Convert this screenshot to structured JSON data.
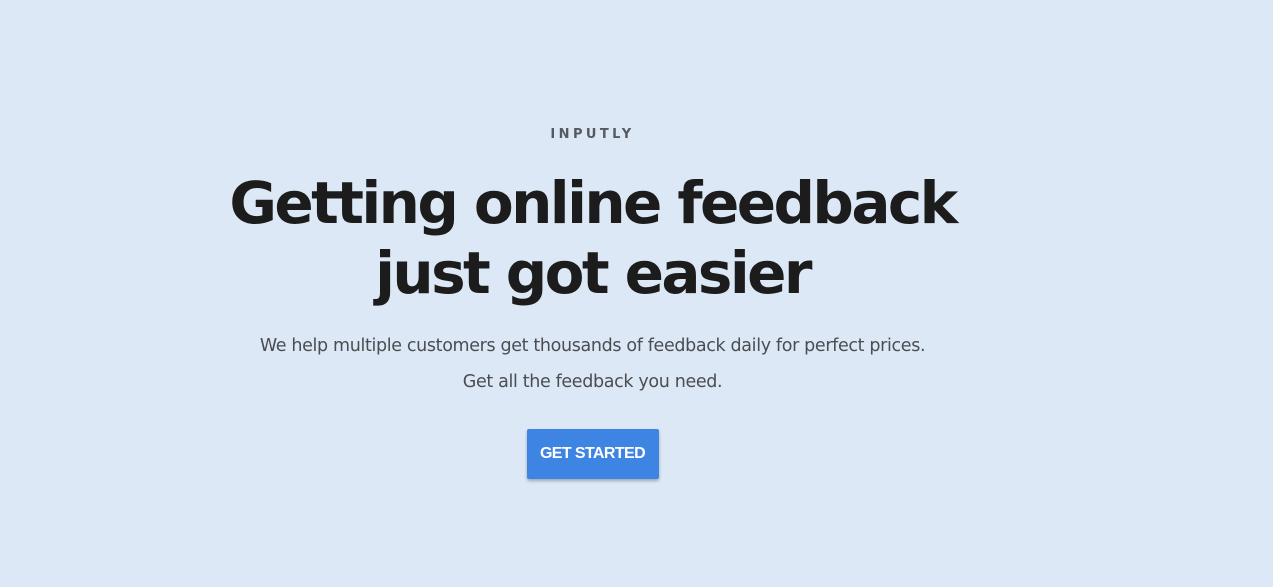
{
  "hero": {
    "brand": "INPUTLY",
    "headline_line1": "Getting online feedback",
    "headline_line2": "just got easier",
    "subtitle_line1": "We help multiple customers get thousands of feedback daily for perfect prices.",
    "subtitle_line2": "Get all the feedback you need.",
    "cta_label": "GET STARTED"
  },
  "colors": {
    "background": "#dce8f5",
    "accent": "#3e85e3",
    "headline": "#1c1c1c",
    "body_text": "#4a4d52"
  }
}
